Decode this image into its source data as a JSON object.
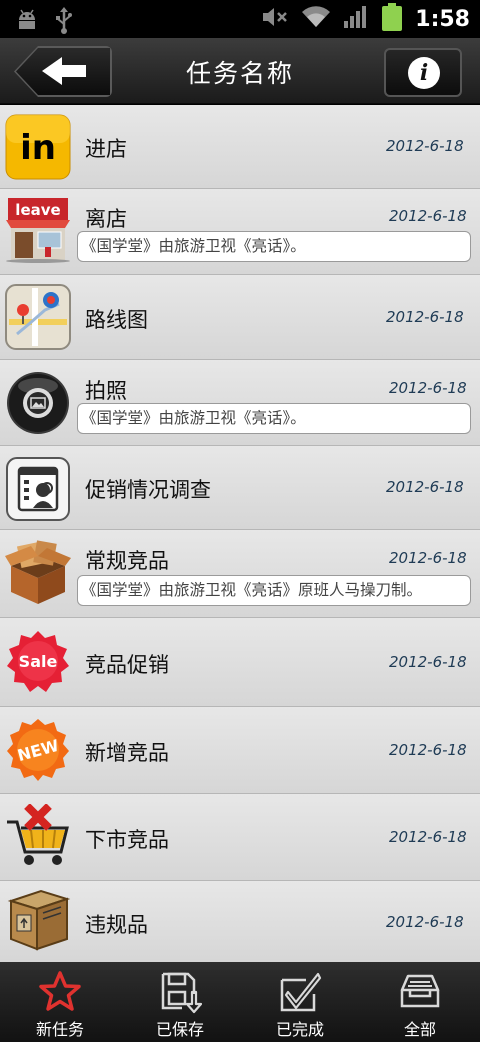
{
  "status_bar": {
    "time": "1:58",
    "icons": [
      "android-debug-icon",
      "usb-icon",
      "mute-icon",
      "wifi-icon",
      "signal-icon",
      "battery-icon"
    ],
    "battery_color": "#8fd14f"
  },
  "header": {
    "title": "任务名称",
    "back_icon": "back-arrow-icon",
    "info_icon": "info-icon",
    "info_glyph": "i"
  },
  "tasks": [
    {
      "name": "进店",
      "date": "2012-6-18",
      "icon": "store-in-icon",
      "icon_text": "in",
      "note": ""
    },
    {
      "name": "离店",
      "date": "2012-6-18",
      "icon": "store-leave-icon",
      "icon_text": "leave",
      "note": "《国学堂》由旅游卫视《亮话》。"
    },
    {
      "name": "路线图",
      "date": "2012-6-18",
      "icon": "map-route-icon",
      "note": ""
    },
    {
      "name": "拍照",
      "date": "2012-6-18",
      "icon": "camera-icon",
      "note": "《国学堂》由旅游卫视《亮话》。"
    },
    {
      "name": "促销情况调查",
      "date": "2012-6-18",
      "icon": "survey-icon",
      "note": ""
    },
    {
      "name": "常规竞品",
      "date": "2012-6-18",
      "icon": "box-icon",
      "note": "《国学堂》由旅游卫视《亮话》原班人马操刀制。"
    },
    {
      "name": "竞品促销",
      "date": "2012-6-18",
      "icon": "sale-badge-icon",
      "icon_text": "Sale",
      "note": ""
    },
    {
      "name": "新增竞品",
      "date": "2012-6-18",
      "icon": "new-badge-icon",
      "icon_text": "NEW",
      "note": ""
    },
    {
      "name": "下市竞品",
      "date": "2012-6-18",
      "icon": "cart-remove-icon",
      "note": ""
    },
    {
      "name": "违规品",
      "date": "2012-6-18",
      "icon": "crate-icon",
      "note": ""
    }
  ],
  "tabs": [
    {
      "label": "新任务",
      "icon": "star-icon",
      "active": true
    },
    {
      "label": "已保存",
      "icon": "save-icon",
      "active": false
    },
    {
      "label": "已完成",
      "icon": "done-check-icon",
      "active": false
    },
    {
      "label": "全部",
      "icon": "inbox-tray-icon",
      "active": false
    }
  ],
  "colors": {
    "accent_red": "#e0322f",
    "date_color": "#1f3b55",
    "list_bg": "#dcdcdc"
  }
}
